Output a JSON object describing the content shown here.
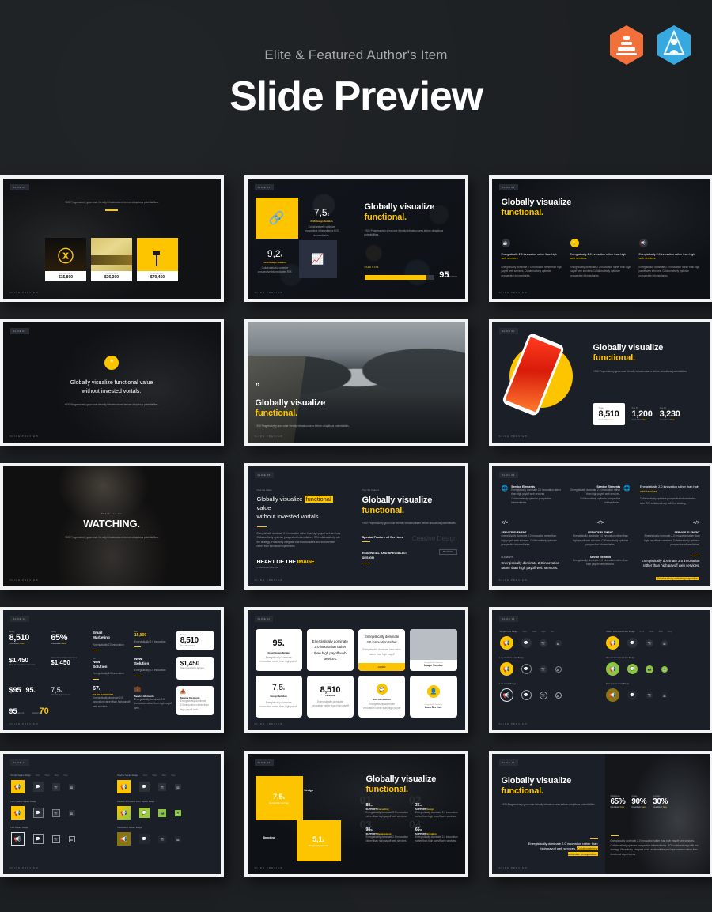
{
  "header": {
    "eyebrow": "Elite & Featured Author's Item",
    "title": "Slide Preview",
    "badges": [
      {
        "name": "elite-author-badge",
        "color": "#f2713a"
      },
      {
        "name": "featured-author-badge",
        "color": "#36a9e1"
      }
    ]
  },
  "theme": {
    "page_bg": "#1c1f22",
    "slide_bg": "#1b1f27",
    "accent_yellow": "#fdc500",
    "card_white": "#ffffff",
    "accent_green": "#8cc63f",
    "frame": "#f2f3f4"
  },
  "common": {
    "heading_line1": "Globally visualize",
    "heading_line2": "functional.",
    "body_text": "+200 Progressively grow user friendly infrastructures before ubiquitous potentialities.",
    "slide_tag": "SLIDE",
    "page_label": "SLIDE PREVIEW"
  },
  "slides": [
    {
      "id": "slide-01-portfolio-cards",
      "tag": "SLIDE 01",
      "caption": "+200 Progressively grow user friendly infrastructures before ubiquitous potentialities.",
      "cards": [
        {
          "label": "Portfolio Item",
          "price": "$15,800"
        },
        {
          "label": "Portfolio Item",
          "price": "$36,300"
        },
        {
          "label": "Portfolio Item",
          "price": "$70,450"
        }
      ]
    },
    {
      "id": "slide-02-stats-tiles",
      "tag": "SLIDE 02",
      "heading_line1": "Globally visualize",
      "heading_line2": "functional.",
      "body": "+200 Progressively grow user friendly infrastructures before ubiquitous potentialities.",
      "stats": [
        {
          "value": "7,5",
          "unit": "k",
          "label": "2018 Design Solution"
        },
        {
          "value": "9,2",
          "unit": "k",
          "label": "2019 Design Solution"
        }
      ],
      "progress": {
        "label": "USER RATE",
        "value": "95",
        "unit": "percent",
        "percent": 88
      }
    },
    {
      "id": "slide-03-three-icon-columns",
      "tag": "SLIDE 03",
      "heading_line1": "Globally visualize",
      "heading_line2": "functional.",
      "columns": [
        {
          "icon": "cup-icon",
          "lead": "Energistically 2.0 innovation rather than high",
          "link": "web services.",
          "body": "Energistically dominate 2.0 innovation rather than high payoff web services. Collaboratively optimize prospective infomediaries."
        },
        {
          "icon": "lightbulb-icon",
          "lead": "Energistically 2.0 innovation rather than high",
          "link": "web services.",
          "body": "Energistically dominate 2.0 innovation rather than high payoff web services. Collaboratively optimize prospective infomediaries."
        },
        {
          "icon": "megaphone-icon",
          "lead": "Energistically 2.0 innovation rather than high",
          "link": "web services.",
          "body": "Energistically dominate 2.0 innovation rather than high payoff web services. Collaboratively optimize prospective infomediaries."
        }
      ]
    },
    {
      "id": "slide-04-quote-center",
      "tag": "SLIDE 04",
      "icon": "quote-icon",
      "quote_line1": "Globally visualize functional value",
      "quote_line2": "without  invested vortals.",
      "body": "+200 Progressively grow user friendly infrastructures before ubiquitous potentialities."
    },
    {
      "id": "slide-05-mountain-quote",
      "tag": "SLIDE 05",
      "icon": "quote-icon",
      "heading_line1": "Globally visualize",
      "heading_line2": "functional.",
      "body": "+200 Progressively grow user friendly infrastructures before ubiquitous potentialities."
    },
    {
      "id": "slide-06-phone-mockup",
      "tag": "SLIDE 06",
      "heading_line1": "Globally visualize",
      "heading_line2": "functional.",
      "body": "+200 Progressively grow user friendly infrastructures before ubiquitous potentialities.",
      "stats": [
        {
          "label": "Today",
          "value": "8,510",
          "sub": "Countdown",
          "sub_accent": "New"
        },
        {
          "label": "Aug 15",
          "value": "1,200",
          "sub": "Countdown",
          "sub_accent": "New"
        },
        {
          "label": "Aug 18",
          "value": "3,230",
          "sub": "Countdown",
          "sub_accent": "New"
        }
      ]
    },
    {
      "id": "slide-07-thank-you",
      "tag": "SLIDE 07",
      "kicker": "Thank you for",
      "title": "WATCHING.",
      "body": "+200 Progressively grow user friendly infrastructures before ubiquitous potentialities."
    },
    {
      "id": "slide-08-typography",
      "tag": "SLIDE 08",
      "left": {
        "eyebrow": "Over the Vision",
        "line1_a": "Globally visualize ",
        "line1_hl": "functional",
        "line1_b": " value",
        "line2": "without  invested vortals.",
        "body": "Energistically dominate 2.0 innovation rather than high payoff web services. Collaboratively optimize prospective infomediaries. ROI collaboratively with the strategy. Proactively integrate viral functionalities and improvement rather than functional experiences.",
        "footer_a": "HEART OF THE ",
        "footer_hl": "IMAGE",
        "footer_sub": "A Passionate Business"
      },
      "right": {
        "eyebrow": "Over the Vision 2",
        "heading_line1": "Globally visualize",
        "heading_line2": "functional.",
        "body": "+200 Progressively grow user friendly infrastructures before ubiquitous potentialities.",
        "item1": "Special Feature of Services",
        "item2_line1": "ESSENTIAL AND SPECIALIST",
        "item2_line2": "DESIGN",
        "watermark": "Creative Design",
        "tag": "BRANDING"
      }
    },
    {
      "id": "slide-09-service-elements",
      "tag": "SLIDE 09",
      "items": [
        {
          "icon": "globe-icon",
          "title": "Service Elements",
          "body": "Energistically dominate 2.0 innovation rather than high payoff web services. Collaboratively optimize prospective infomediaries.",
          "align": "left"
        },
        {
          "icon": "globe-icon",
          "title": "Service Elements",
          "body": "Energistically dominate 2.0 innovation rather than high payoff web services. Collaboratively optimize prospective infomediaries.",
          "align": "right"
        },
        {
          "icon": "",
          "title": "Energistically 2.0 innovation rather than high",
          "link": "web services.",
          "body": "Collaboratively optimize prospective infomediaries after ROI collaboratively with the strategy.",
          "align": "left"
        },
        {
          "icon": "code-icon",
          "title": "SERVICE ELEMENT",
          "body": "Energistically dominate 2.0 innovation rather than high payoff web services. Collaboratively optimize prospective infomediaries.",
          "align": "left"
        },
        {
          "icon": "code-icon",
          "title": "SERVICE ELEMENT",
          "body": "Energistically dominate 2.0 innovation rather than high payoff web services. Collaboratively optimize prospective infomediaries.",
          "align": "center"
        },
        {
          "icon": "code-icon",
          "title": "SERVICE ELEMENT",
          "body": "Energistically dominate 2.0 innovation rather than high payoff web services. Collaboratively optimize prospective infomediaries.",
          "align": "right"
        },
        {
          "icon": "",
          "title": "ELEMENTS",
          "body": "Energistically dominate 2.0 innovation rather than high payoff web services.",
          "align": "left"
        },
        {
          "icon": "",
          "title": "Service Elements",
          "body": "Energistically dominate 2.0 innovation rather than high payoff web services.",
          "align": "center"
        },
        {
          "icon": "",
          "title": "Energistically dominate 2.0 innovation rather than high payoff web services.",
          "link": "Collaboratively optimize prospective.",
          "body": "",
          "align": "right"
        }
      ]
    },
    {
      "id": "slide-10-data-grid",
      "tag": "SLIDE 10",
      "cells": [
        {
          "label": "Today",
          "value": "8,510",
          "sub": "Countdown",
          "sub_accent": "New"
        },
        {
          "label": "Today",
          "value": "65%",
          "sub": "Countdown",
          "sub_accent": "New"
        },
        {
          "title_line1": "Email",
          "title_line2": "Marketing",
          "body": "Energistically 2.0 innovation"
        },
        {
          "label": "New",
          "value": "15,800",
          "body": "Energistically 2.0 innovation"
        },
        {
          "label": "Today",
          "value": "8,510",
          "sub": "Countdown New",
          "style": "white-card"
        },
        {
          "value": "$1,450",
          "sub": "Total of Countdown Services"
        },
        {
          "label": "Total of Countdown Services",
          "value": "$1,450"
        },
        {
          "num": "99",
          "title_line1": "New",
          "title_line2": "Solution",
          "body": "Energistically 2.0 innovation"
        },
        {
          "num": "04",
          "title_line1": "New",
          "title_line2": "Solution",
          "body": "Energistically 2.0 innovation"
        },
        {
          "value": "$1,450",
          "sub": "Total of Countdown Services",
          "style": "white-card"
        },
        {
          "value": "$95",
          "value2": "95."
        },
        {
          "value": "7,5",
          "unit": "k",
          "sub": "UI UX Design Courses"
        },
        {
          "value": "95",
          "sub": "percent",
          "value2": "70",
          "sub2": "Solution"
        },
        {
          "value": "67",
          "unit": "k",
          "title": "MAJOR ELEMENTS",
          "body": "Energistically dominate 2.0 innovation rather than high payoff web services."
        },
        {
          "icon": "briefcase-icon",
          "title": "Service Elements",
          "body": "Energistically dominate 2.0 innovation rather than high payoff web."
        },
        {
          "icon": "inbox-icon",
          "title": "Service Elements",
          "body": "Energistically dominate 2.0 innovation rather than high payoff web.",
          "style": "white-card"
        }
      ]
    },
    {
      "id": "slide-11-white-cards",
      "tag": "SLIDE 11",
      "cards": [
        {
          "value": "95",
          "unit": ".",
          "title": "Great Design Simple",
          "body": "Energistically dominate innovation rather than high payoff"
        },
        {
          "body_large": "Energistically dominate 2.0 innovation rather than high payoff web services."
        },
        {
          "body_large": "Energistically dominate 2.0 innovation rather",
          "body": "Energistically dominate innovation rather than high payoff",
          "button": "LEARN"
        },
        {
          "kicker": "Energistically Dominate",
          "title": "Image Service",
          "style": "image-top"
        },
        {
          "value": "7,5",
          "unit": "k",
          "title": "Design Solution",
          "body": "Energistically dominate innovation rather than high payoff"
        },
        {
          "label": "Today",
          "value": "8,510",
          "title": "Facebook",
          "body": "Energistically dominate innovation rather than high payoff"
        },
        {
          "icon": "chat-icon",
          "title": "Icon this Moment",
          "body": "Energistically dominate innovation rather than high payoff"
        },
        {
          "icon": "user-icon",
          "kicker": "Energistically Dominate",
          "title": "Icon Service"
        }
      ]
    },
    {
      "id": "slide-12-circle-icons",
      "tag": "SLIDE 12",
      "groups": [
        {
          "title": "Simple Color Badge",
          "legend": [
            "Copy",
            "Paste",
            "Align",
            "Text"
          ],
          "style": "filled",
          "color": "#fdc500"
        },
        {
          "title": "Outline & Gradient Color Badge",
          "legend": [
            "Color",
            "Share",
            "Mute",
            "Copy"
          ],
          "style": "filled",
          "color": "#fdc500"
        },
        {
          "title": "Line Gradient Color Badge",
          "legend": [],
          "style": "outline",
          "color": "#fdc500"
        },
        {
          "title": "Rounded Gradient Color Badge",
          "legend": [],
          "style": "filled",
          "color": "#8cc63f"
        },
        {
          "title": "Line Circle Badge",
          "legend": [],
          "style": "outline",
          "color": "#ffffff"
        },
        {
          "title": "Transparent Circle Badge",
          "legend": [],
          "style": "filled",
          "color": "#8a7412"
        }
      ],
      "icons": [
        "megaphone-icon",
        "chat-icon",
        "camera-icon",
        "monitor-icon"
      ]
    },
    {
      "id": "slide-13-square-icons",
      "tag": "SLIDE 13",
      "groups": [
        {
          "title": "Simple Square Badge",
          "legend": [
            "Color",
            "Share",
            "Mute",
            "Copy"
          ],
          "style": "filled",
          "color": "#fdc500"
        },
        {
          "title": "Shadow Square Badge",
          "legend": [
            "Color",
            "Share",
            "Mute",
            "Copy"
          ],
          "style": "filled",
          "color": "#fdc500"
        },
        {
          "title": "Line Shadow Square Badge",
          "legend": [],
          "style": "shadow",
          "color": "#fdc500"
        },
        {
          "title": "Gradient & Gradient Color Square Badge",
          "legend": [],
          "style": "filled",
          "color": "#8cc63f"
        },
        {
          "title": "Line Square Badge",
          "legend": [],
          "style": "outline",
          "color": "#ffffff"
        },
        {
          "title": "Transparent Square Badge",
          "legend": [],
          "style": "filled",
          "color": "#8a7412"
        }
      ],
      "icons": [
        "megaphone-icon",
        "chat-icon",
        "camera-icon",
        "monitor-icon"
      ]
    },
    {
      "id": "slide-14-tiles-support",
      "tag": "SLIDE 14",
      "heading_line1": "Globally visualize",
      "heading_line2": "functional.",
      "tiles": [
        {
          "value": "7,5",
          "unit": "k",
          "sub": "Energistically dominate"
        },
        {
          "label": "Design"
        },
        {
          "label": "Branding"
        },
        {
          "value": "5,1",
          "unit": "k",
          "sub": "Energistically dominate"
        }
      ],
      "items": [
        {
          "num": "01",
          "value": "88",
          "unit": "%",
          "title_a": "SUPPORT ",
          "title_hl": "Consulting",
          "body": "Energistically dominate 2.0 innovation rather than high payoff web services."
        },
        {
          "num": "02",
          "value": "35",
          "unit": "%",
          "title_a": "SUPPORT ",
          "title_hl": "Design",
          "body": "Energistically dominate 2.0 innovation rather than high payoff web services."
        },
        {
          "num": "03",
          "value": "98",
          "unit": "%",
          "title_a": "SUPPORT ",
          "title_hl": "Development",
          "body": "Energistically dominate 2.0 innovation rather than high payoff web services."
        },
        {
          "num": "04",
          "value": "66",
          "unit": "%",
          "title_a": "SUPPORT ",
          "title_hl": "Branding",
          "body": "Energistically dominate 2.0 innovation rather than high payoff web services."
        }
      ]
    },
    {
      "id": "slide-15-percent-stats",
      "tag": "SLIDE 15",
      "heading_line1": "Globally visualize",
      "heading_line2": "functional.",
      "body": "+200 Progressively grow user friendly infrastructures before ubiquitous potentialities.",
      "stats": [
        {
          "label": "Collaborate",
          "value": "65%",
          "sub": "Countdown",
          "sub_accent": "New"
        },
        {
          "label": "Create",
          "value": "90%",
          "sub": "Countdown",
          "sub_accent": "New"
        },
        {
          "label": "Innovate",
          "value": "30%",
          "sub": "Countdown",
          "sub_accent": "New"
        }
      ],
      "left_body_a": "Energistically dominate 2.0 innovation rather than high payoff web services.",
      "left_body_hl": "Collaboratively optimize prospective.",
      "right_body": "Energistically dominate 2.0 innovation rather than high payoff web services. Collaboratively optimize prospective infomediaries. ROI collaboratively with the strategy. Proactively integrate viral functionalities and improvement rather than functional experiences."
    }
  ]
}
